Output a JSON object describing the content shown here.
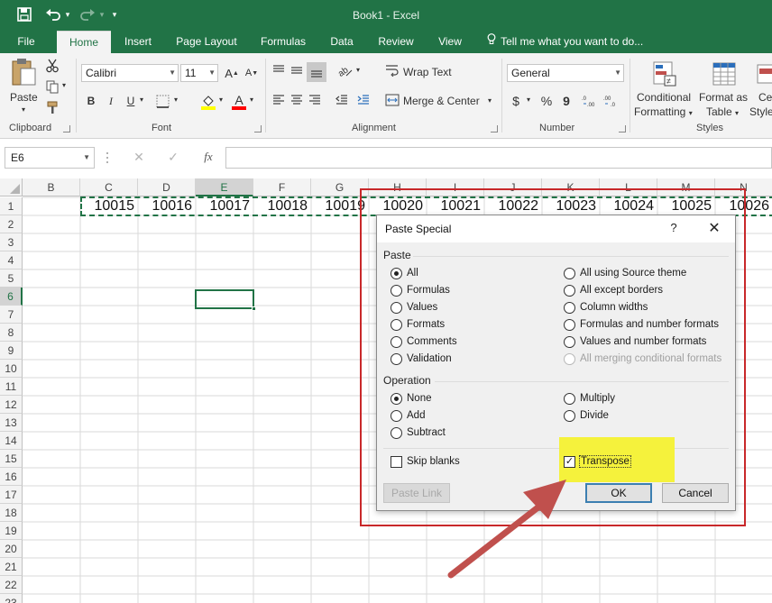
{
  "app": {
    "title": "Book1 - Excel",
    "theme_color": "#217346"
  },
  "qat": {
    "save_icon": "save-icon",
    "undo_icon": "undo-icon",
    "redo_icon": "redo-icon",
    "customize_icon": "customize-qat-icon"
  },
  "tabs": {
    "file": "File",
    "home": "Home",
    "insert": "Insert",
    "page_layout": "Page Layout",
    "formulas": "Formulas",
    "data": "Data",
    "review": "Review",
    "view": "View",
    "tell_me": "Tell me what you want to do..."
  },
  "ribbon": {
    "clipboard": {
      "label": "Clipboard",
      "paste": "Paste"
    },
    "font": {
      "label": "Font",
      "font_name": "Calibri",
      "font_size": "11",
      "bold": "B",
      "italic": "I",
      "underline": "U",
      "grow": "A",
      "shrink": "A",
      "font_color_icon": "A"
    },
    "alignment": {
      "label": "Alignment",
      "wrap_text": "Wrap Text",
      "merge_center": "Merge & Center"
    },
    "number": {
      "label": "Number",
      "format": "General",
      "currency": "$",
      "percent": "%",
      "comma": "9"
    },
    "styles": {
      "label": "Styles",
      "conditional_1": "Conditional",
      "conditional_2": "Formatting",
      "format_table_1": "Format as",
      "format_table_2": "Table",
      "cell_1": "Ce",
      "cell_2": "Style"
    }
  },
  "formula_bar": {
    "name_box": "E6",
    "cancel": "✕",
    "enter": "✓",
    "fx": "fx",
    "value": ""
  },
  "sheet": {
    "columns": [
      "B",
      "C",
      "D",
      "E",
      "F",
      "G",
      "H",
      "I",
      "J",
      "K",
      "L",
      "M",
      "N"
    ],
    "selected_column": "E",
    "rows": [
      "1",
      "2",
      "3",
      "4",
      "5",
      "6",
      "7",
      "8",
      "9",
      "10",
      "11",
      "12",
      "13",
      "14",
      "15",
      "16",
      "17",
      "18",
      "19",
      "20",
      "21",
      "22",
      "23"
    ],
    "selected_row": "6",
    "active_cell": "E6",
    "row1_values": [
      "10015",
      "10016",
      "10017",
      "10018",
      "10019",
      "10020",
      "10021",
      "10022",
      "10023",
      "10024",
      "10025",
      "10026"
    ]
  },
  "dialog": {
    "title": "Paste Special",
    "help": "?",
    "close": "✕",
    "paste_section": "Paste",
    "paste_left": [
      "All",
      "Formulas",
      "Values",
      "Formats",
      "Comments",
      "Validation"
    ],
    "paste_right": [
      "All using Source theme",
      "All except borders",
      "Column widths",
      "Formulas and number formats",
      "Values and number formats",
      "All merging conditional formats"
    ],
    "paste_selected": "All",
    "operation_section": "Operation",
    "operation_left": [
      "None",
      "Add",
      "Subtract"
    ],
    "operation_right": [
      "Multiply",
      "Divide"
    ],
    "operation_selected": "None",
    "skip_blanks": "Skip blanks",
    "skip_blanks_checked": false,
    "transpose": "Transpose",
    "transpose_checked": true,
    "paste_link": "Paste Link",
    "ok": "OK",
    "cancel": "Cancel"
  },
  "annotations": {
    "highlight_color": "#c8282a",
    "transpose_highlight": "#f5f23c",
    "arrow_color": "#c0504d"
  }
}
